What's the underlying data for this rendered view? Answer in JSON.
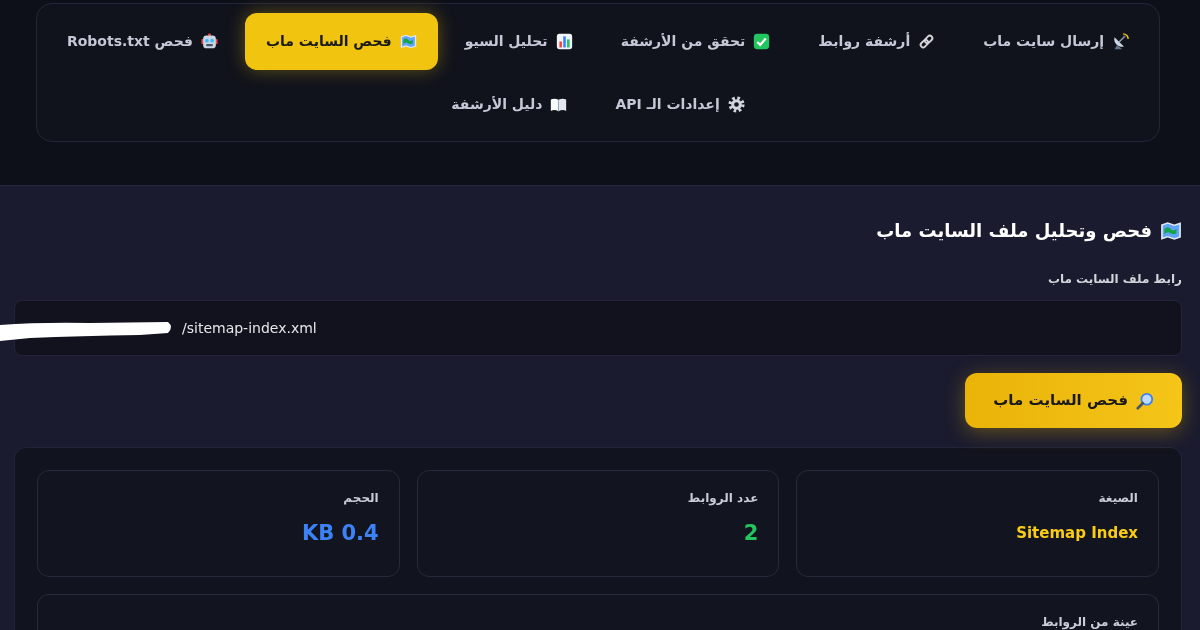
{
  "tab_rows": [
    [
      {
        "label": "إرسال سايت ماب",
        "selected": false
      },
      {
        "label": "أرشفة روابط",
        "selected": false
      },
      {
        "label": "تحقق من الأرشفة",
        "selected": false
      },
      {
        "label": "تحليل السيو",
        "selected": false
      },
      {
        "label": "فحص السايت ماب",
        "selected": true
      },
      {
        "label": "فحص Robots.txt",
        "selected": false
      }
    ],
    [
      {
        "label": "إعدادات الـ API",
        "selected": false
      },
      {
        "label": "دليل الأرشفة",
        "selected": false
      }
    ]
  ],
  "sitemap_checker": {
    "title": "فحص وتحليل ملف السايت ماب",
    "url_field": {
      "label": "رابط ملف السايت ماب",
      "value": "/sitemap-index.xml"
    },
    "check_button": "فحص السايت ماب"
  },
  "results": {
    "stats": [
      {
        "kind": "text",
        "label": "الصيغة",
        "value": "Sitemap Index",
        "color": "#facc15"
      },
      {
        "kind": "number",
        "label": "عدد الروابط",
        "value": "2",
        "color": "#22c55e"
      },
      {
        "kind": "number",
        "label": "الحجم",
        "value": "KB 0.4",
        "color": "#3b82f6"
      }
    ],
    "sample_links": {
      "label": "عينة من الروابط"
    }
  }
}
